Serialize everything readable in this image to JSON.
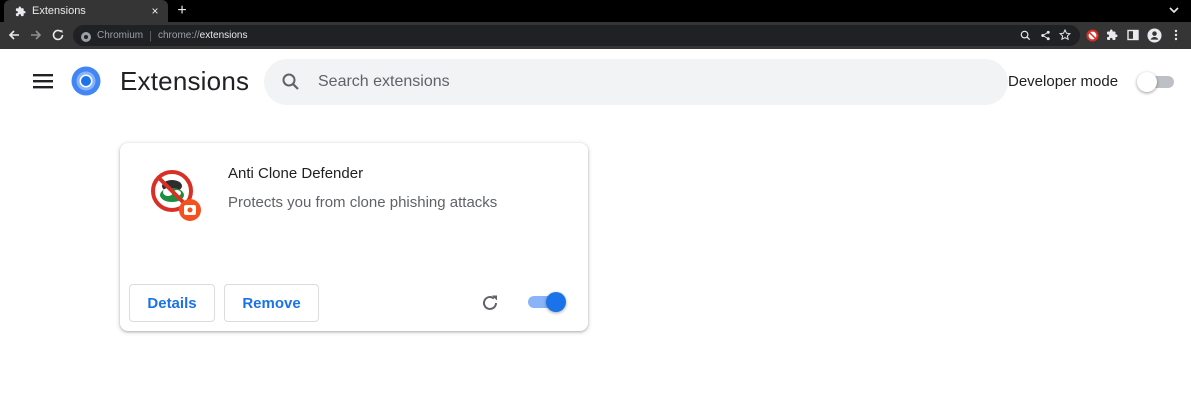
{
  "browser": {
    "tab_title": "Extensions",
    "new_tab_symbol": "+",
    "tab_close_symbol": "×",
    "omnibox_domain": "Chromium",
    "omnibox_separator": "|",
    "omnibox_scheme": "chrome://",
    "omnibox_path": "extensions"
  },
  "page": {
    "title": "Extensions",
    "search_placeholder": "Search extensions",
    "developer_mode_label": "Developer mode",
    "developer_mode_on": false
  },
  "extensions": [
    {
      "name": "Anti Clone Defender",
      "description": "Protects you from clone phishing attacks",
      "details_label": "Details",
      "remove_label": "Remove",
      "enabled": true
    }
  ],
  "colors": {
    "accent": "#1a73e8",
    "toggle_track_on": "#8ab4f8",
    "toolbar_bg": "#353535",
    "omnibox_bg": "#202124"
  },
  "icons": [
    "puzzle-icon",
    "back-icon",
    "forward-icon",
    "reload-icon",
    "site-info-icon",
    "zoom-icon",
    "share-icon",
    "bookmark-star-icon",
    "extension-icon",
    "extensions-menu-icon",
    "side-panel-icon",
    "profile-icon",
    "kebab-menu-icon",
    "hamburger-menu-icon",
    "chrome-logo-icon",
    "search-icon"
  ]
}
